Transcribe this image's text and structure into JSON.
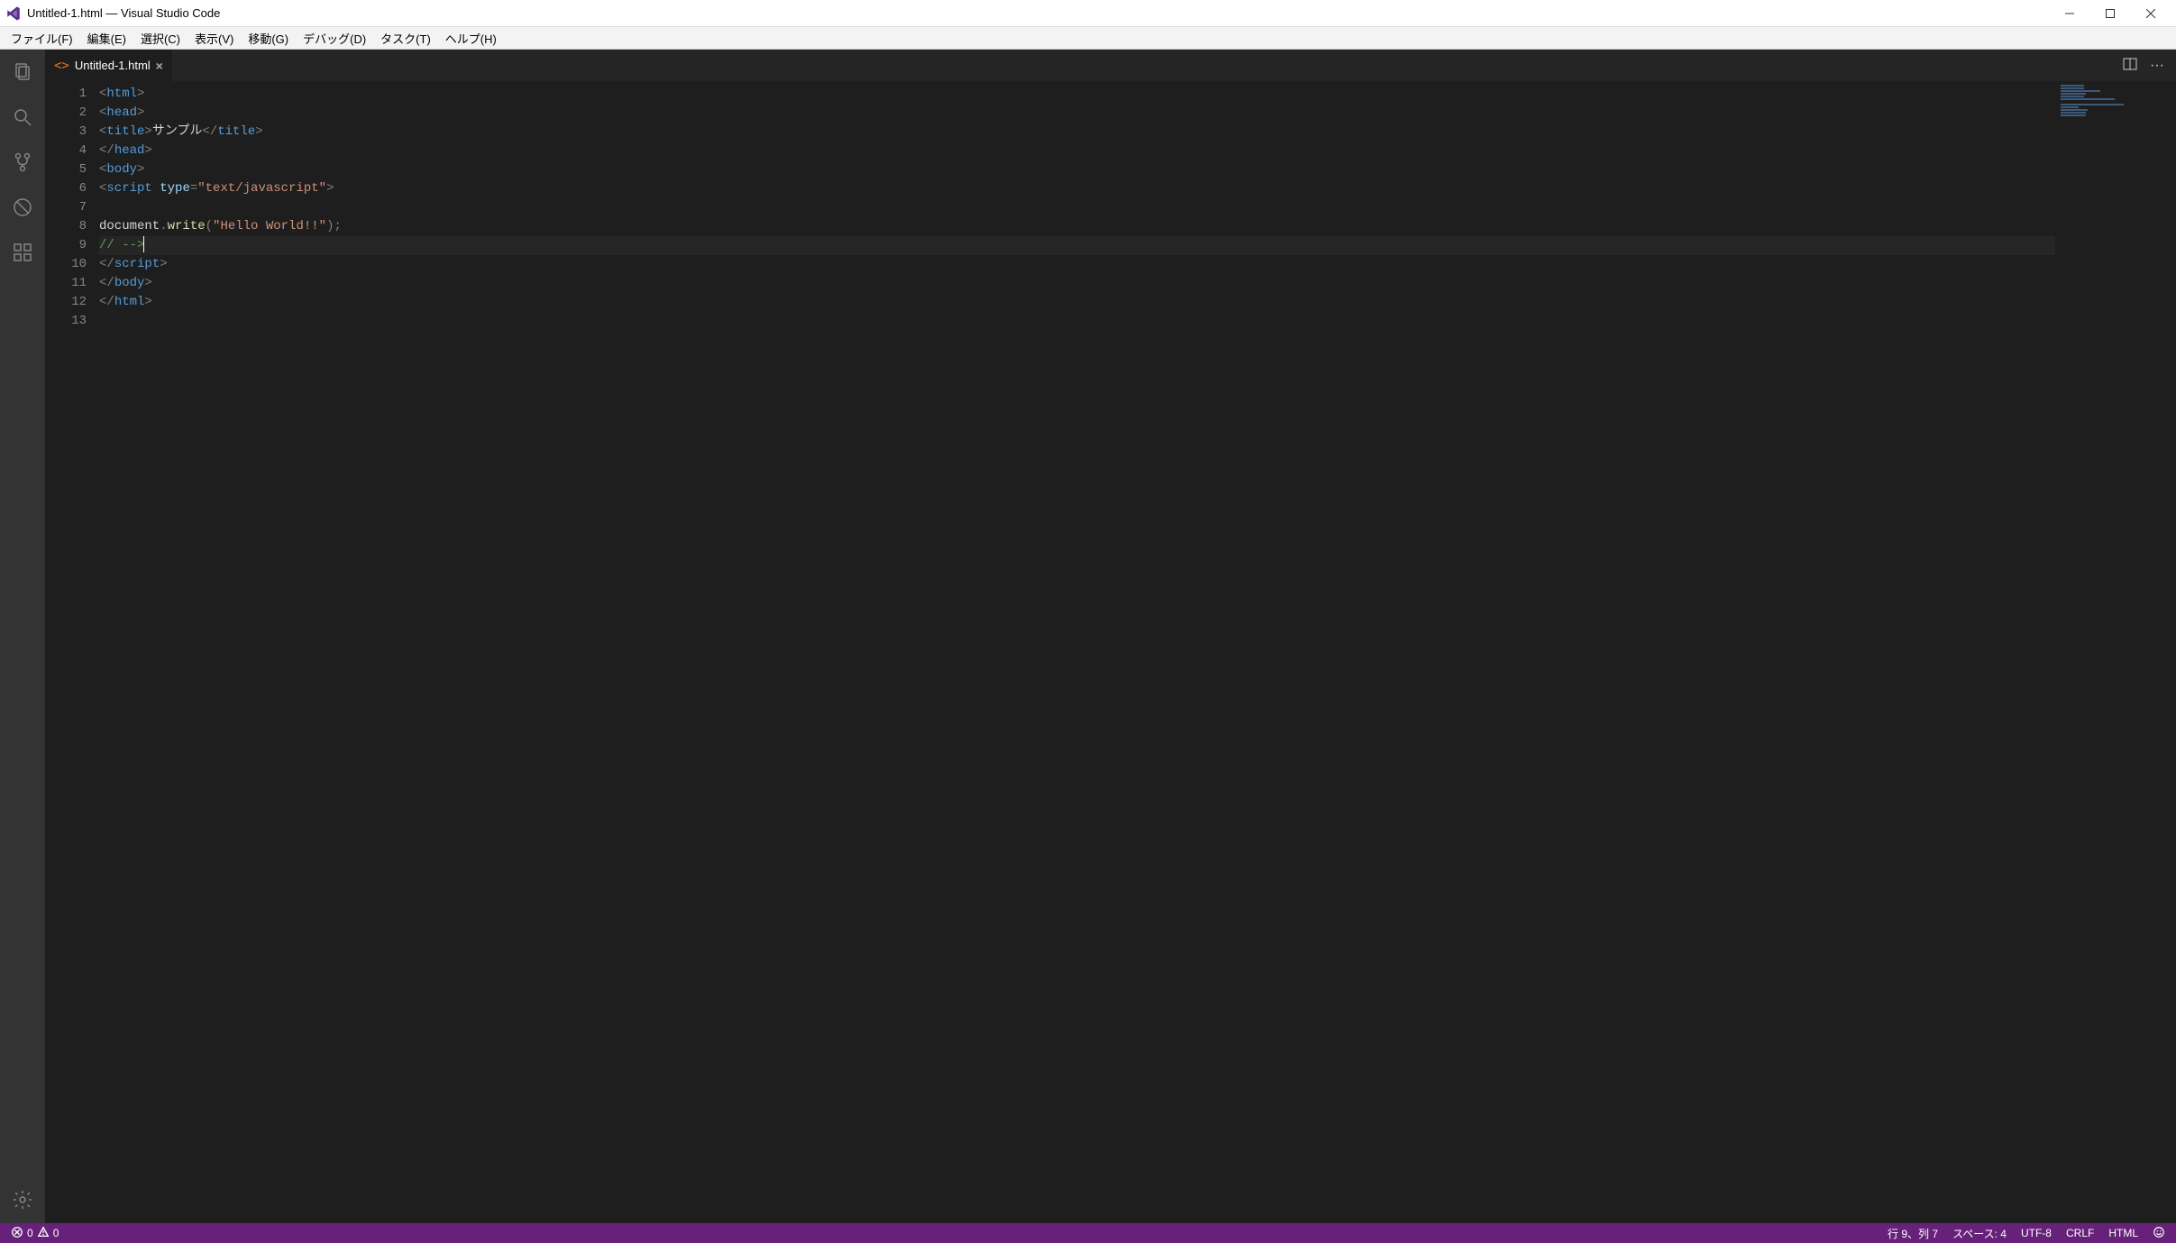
{
  "titlebar": {
    "title": "Untitled-1.html — Visual Studio Code"
  },
  "menu": {
    "file": "ファイル(F)",
    "edit": "編集(E)",
    "select": "選択(C)",
    "view": "表示(V)",
    "go": "移動(G)",
    "debug": "デバッグ(D)",
    "task": "タスク(T)",
    "help": "ヘルプ(H)"
  },
  "tab": {
    "icon": "<>",
    "filename": "Untitled-1.html",
    "close": "×"
  },
  "code": {
    "lines": [
      {
        "num": "1",
        "tokens": [
          [
            "punct",
            "<"
          ],
          [
            "tagname",
            "html"
          ],
          [
            "punct",
            ">"
          ]
        ]
      },
      {
        "num": "2",
        "tokens": [
          [
            "punct",
            "<"
          ],
          [
            "tagname",
            "head"
          ],
          [
            "punct",
            ">"
          ]
        ]
      },
      {
        "num": "3",
        "tokens": [
          [
            "punct",
            "<"
          ],
          [
            "tagname",
            "title"
          ],
          [
            "punct",
            ">"
          ],
          [
            "ident",
            "サンプル"
          ],
          [
            "punct",
            "</"
          ],
          [
            "tagname",
            "title"
          ],
          [
            "punct",
            ">"
          ]
        ]
      },
      {
        "num": "4",
        "tokens": [
          [
            "punct",
            "</"
          ],
          [
            "tagname",
            "head"
          ],
          [
            "punct",
            ">"
          ]
        ]
      },
      {
        "num": "5",
        "tokens": [
          [
            "punct",
            "<"
          ],
          [
            "tagname",
            "body"
          ],
          [
            "punct",
            ">"
          ]
        ]
      },
      {
        "num": "6",
        "tokens": [
          [
            "punct",
            "<"
          ],
          [
            "tagname",
            "script"
          ],
          [
            "ident",
            " "
          ],
          [
            "attrname",
            "type"
          ],
          [
            "punct",
            "="
          ],
          [
            "attrval",
            "\"text/javascript\""
          ],
          [
            "punct",
            ">"
          ]
        ]
      },
      {
        "num": "7",
        "tokens": []
      },
      {
        "num": "8",
        "tokens": [
          [
            "ident",
            "document"
          ],
          [
            "punct",
            "."
          ],
          [
            "method",
            "write"
          ],
          [
            "punct",
            "("
          ],
          [
            "string",
            "\"Hello World!!\""
          ],
          [
            "punct",
            ");"
          ]
        ]
      },
      {
        "num": "9",
        "tokens": [
          [
            "comment",
            "// -->"
          ]
        ],
        "current": true,
        "cursor": true
      },
      {
        "num": "10",
        "tokens": [
          [
            "punct",
            "</"
          ],
          [
            "tagname",
            "script"
          ],
          [
            "punct",
            ">"
          ]
        ]
      },
      {
        "num": "11",
        "tokens": [
          [
            "punct",
            "</"
          ],
          [
            "tagname",
            "body"
          ],
          [
            "punct",
            ">"
          ]
        ]
      },
      {
        "num": "12",
        "tokens": [
          [
            "punct",
            "</"
          ],
          [
            "tagname",
            "html"
          ],
          [
            "punct",
            ">"
          ]
        ]
      },
      {
        "num": "13",
        "tokens": []
      }
    ]
  },
  "status": {
    "errors": "0",
    "warnings": "0",
    "cursor": "行 9、列 7",
    "spaces": "スペース: 4",
    "encoding": "UTF-8",
    "eol": "CRLF",
    "lang": "HTML"
  }
}
